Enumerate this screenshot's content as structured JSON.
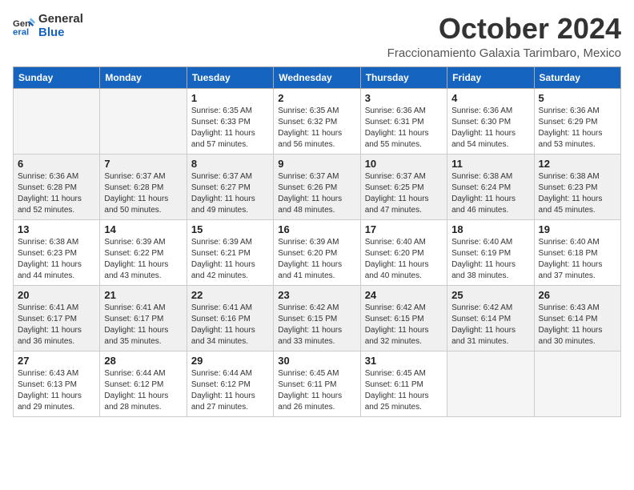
{
  "header": {
    "logo_line1": "General",
    "logo_line2": "Blue",
    "month_title": "October 2024",
    "location": "Fraccionamiento Galaxia Tarimbaro, Mexico"
  },
  "weekdays": [
    "Sunday",
    "Monday",
    "Tuesday",
    "Wednesday",
    "Thursday",
    "Friday",
    "Saturday"
  ],
  "weeks": [
    [
      {
        "day": "",
        "sunrise": "",
        "sunset": "",
        "daylight": ""
      },
      {
        "day": "",
        "sunrise": "",
        "sunset": "",
        "daylight": ""
      },
      {
        "day": "1",
        "sunrise": "Sunrise: 6:35 AM",
        "sunset": "Sunset: 6:33 PM",
        "daylight": "Daylight: 11 hours and 57 minutes."
      },
      {
        "day": "2",
        "sunrise": "Sunrise: 6:35 AM",
        "sunset": "Sunset: 6:32 PM",
        "daylight": "Daylight: 11 hours and 56 minutes."
      },
      {
        "day": "3",
        "sunrise": "Sunrise: 6:36 AM",
        "sunset": "Sunset: 6:31 PM",
        "daylight": "Daylight: 11 hours and 55 minutes."
      },
      {
        "day": "4",
        "sunrise": "Sunrise: 6:36 AM",
        "sunset": "Sunset: 6:30 PM",
        "daylight": "Daylight: 11 hours and 54 minutes."
      },
      {
        "day": "5",
        "sunrise": "Sunrise: 6:36 AM",
        "sunset": "Sunset: 6:29 PM",
        "daylight": "Daylight: 11 hours and 53 minutes."
      }
    ],
    [
      {
        "day": "6",
        "sunrise": "Sunrise: 6:36 AM",
        "sunset": "Sunset: 6:28 PM",
        "daylight": "Daylight: 11 hours and 52 minutes."
      },
      {
        "day": "7",
        "sunrise": "Sunrise: 6:37 AM",
        "sunset": "Sunset: 6:28 PM",
        "daylight": "Daylight: 11 hours and 50 minutes."
      },
      {
        "day": "8",
        "sunrise": "Sunrise: 6:37 AM",
        "sunset": "Sunset: 6:27 PM",
        "daylight": "Daylight: 11 hours and 49 minutes."
      },
      {
        "day": "9",
        "sunrise": "Sunrise: 6:37 AM",
        "sunset": "Sunset: 6:26 PM",
        "daylight": "Daylight: 11 hours and 48 minutes."
      },
      {
        "day": "10",
        "sunrise": "Sunrise: 6:37 AM",
        "sunset": "Sunset: 6:25 PM",
        "daylight": "Daylight: 11 hours and 47 minutes."
      },
      {
        "day": "11",
        "sunrise": "Sunrise: 6:38 AM",
        "sunset": "Sunset: 6:24 PM",
        "daylight": "Daylight: 11 hours and 46 minutes."
      },
      {
        "day": "12",
        "sunrise": "Sunrise: 6:38 AM",
        "sunset": "Sunset: 6:23 PM",
        "daylight": "Daylight: 11 hours and 45 minutes."
      }
    ],
    [
      {
        "day": "13",
        "sunrise": "Sunrise: 6:38 AM",
        "sunset": "Sunset: 6:23 PM",
        "daylight": "Daylight: 11 hours and 44 minutes."
      },
      {
        "day": "14",
        "sunrise": "Sunrise: 6:39 AM",
        "sunset": "Sunset: 6:22 PM",
        "daylight": "Daylight: 11 hours and 43 minutes."
      },
      {
        "day": "15",
        "sunrise": "Sunrise: 6:39 AM",
        "sunset": "Sunset: 6:21 PM",
        "daylight": "Daylight: 11 hours and 42 minutes."
      },
      {
        "day": "16",
        "sunrise": "Sunrise: 6:39 AM",
        "sunset": "Sunset: 6:20 PM",
        "daylight": "Daylight: 11 hours and 41 minutes."
      },
      {
        "day": "17",
        "sunrise": "Sunrise: 6:40 AM",
        "sunset": "Sunset: 6:20 PM",
        "daylight": "Daylight: 11 hours and 40 minutes."
      },
      {
        "day": "18",
        "sunrise": "Sunrise: 6:40 AM",
        "sunset": "Sunset: 6:19 PM",
        "daylight": "Daylight: 11 hours and 38 minutes."
      },
      {
        "day": "19",
        "sunrise": "Sunrise: 6:40 AM",
        "sunset": "Sunset: 6:18 PM",
        "daylight": "Daylight: 11 hours and 37 minutes."
      }
    ],
    [
      {
        "day": "20",
        "sunrise": "Sunrise: 6:41 AM",
        "sunset": "Sunset: 6:17 PM",
        "daylight": "Daylight: 11 hours and 36 minutes."
      },
      {
        "day": "21",
        "sunrise": "Sunrise: 6:41 AM",
        "sunset": "Sunset: 6:17 PM",
        "daylight": "Daylight: 11 hours and 35 minutes."
      },
      {
        "day": "22",
        "sunrise": "Sunrise: 6:41 AM",
        "sunset": "Sunset: 6:16 PM",
        "daylight": "Daylight: 11 hours and 34 minutes."
      },
      {
        "day": "23",
        "sunrise": "Sunrise: 6:42 AM",
        "sunset": "Sunset: 6:15 PM",
        "daylight": "Daylight: 11 hours and 33 minutes."
      },
      {
        "day": "24",
        "sunrise": "Sunrise: 6:42 AM",
        "sunset": "Sunset: 6:15 PM",
        "daylight": "Daylight: 11 hours and 32 minutes."
      },
      {
        "day": "25",
        "sunrise": "Sunrise: 6:42 AM",
        "sunset": "Sunset: 6:14 PM",
        "daylight": "Daylight: 11 hours and 31 minutes."
      },
      {
        "day": "26",
        "sunrise": "Sunrise: 6:43 AM",
        "sunset": "Sunset: 6:14 PM",
        "daylight": "Daylight: 11 hours and 30 minutes."
      }
    ],
    [
      {
        "day": "27",
        "sunrise": "Sunrise: 6:43 AM",
        "sunset": "Sunset: 6:13 PM",
        "daylight": "Daylight: 11 hours and 29 minutes."
      },
      {
        "day": "28",
        "sunrise": "Sunrise: 6:44 AM",
        "sunset": "Sunset: 6:12 PM",
        "daylight": "Daylight: 11 hours and 28 minutes."
      },
      {
        "day": "29",
        "sunrise": "Sunrise: 6:44 AM",
        "sunset": "Sunset: 6:12 PM",
        "daylight": "Daylight: 11 hours and 27 minutes."
      },
      {
        "day": "30",
        "sunrise": "Sunrise: 6:45 AM",
        "sunset": "Sunset: 6:11 PM",
        "daylight": "Daylight: 11 hours and 26 minutes."
      },
      {
        "day": "31",
        "sunrise": "Sunrise: 6:45 AM",
        "sunset": "Sunset: 6:11 PM",
        "daylight": "Daylight: 11 hours and 25 minutes."
      },
      {
        "day": "",
        "sunrise": "",
        "sunset": "",
        "daylight": ""
      },
      {
        "day": "",
        "sunrise": "",
        "sunset": "",
        "daylight": ""
      }
    ]
  ]
}
